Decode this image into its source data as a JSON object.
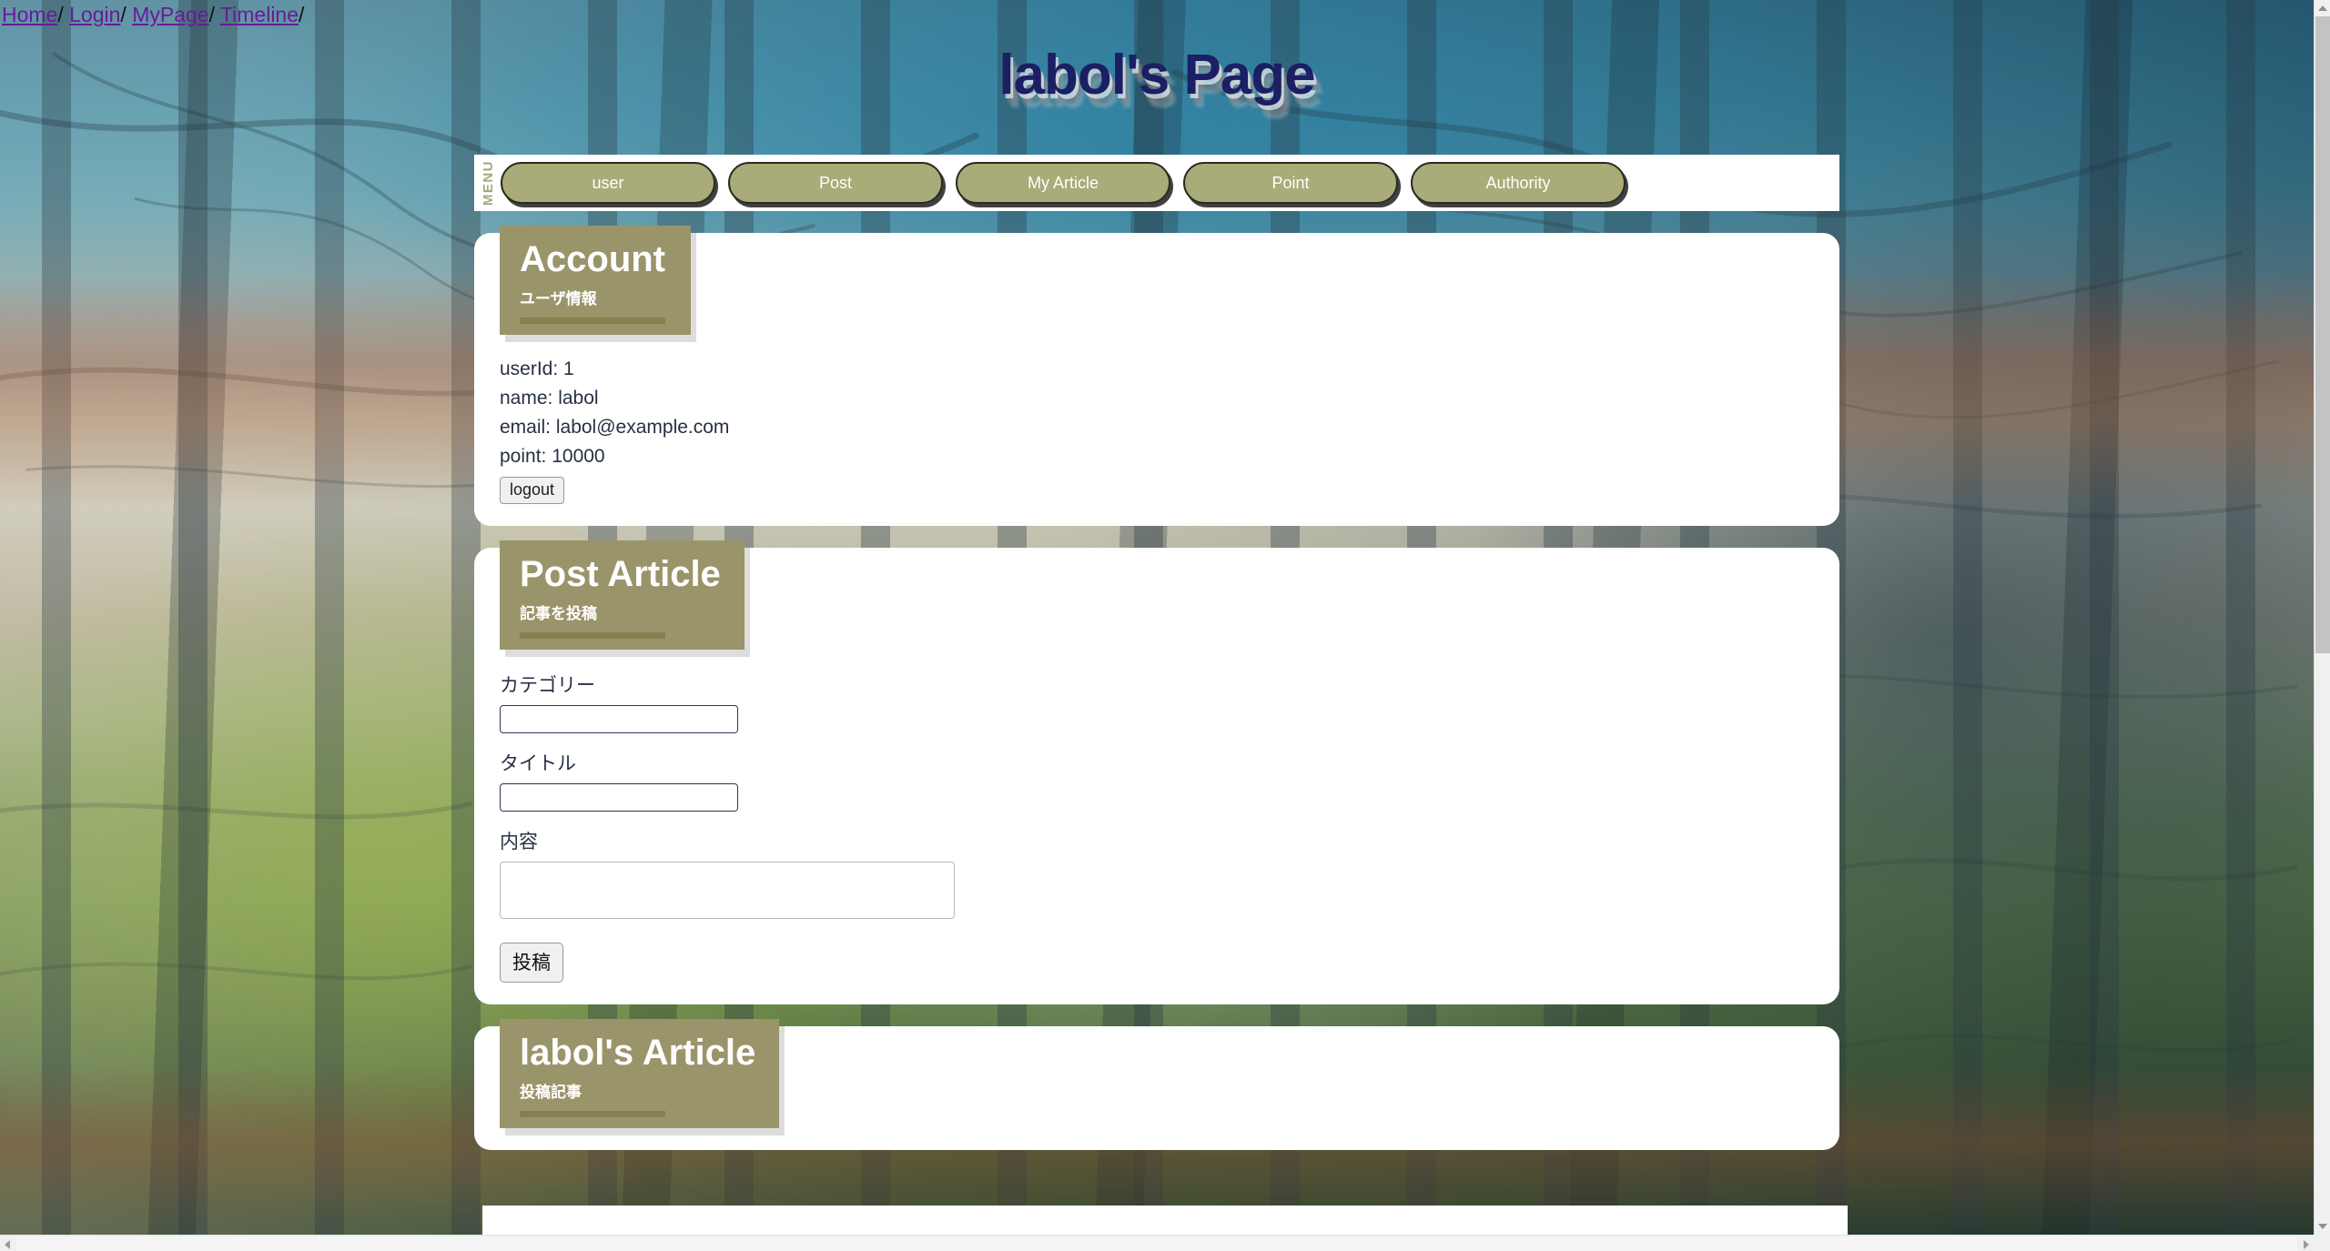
{
  "breadcrumb": {
    "items": [
      {
        "label": "Home",
        "href": "#"
      },
      {
        "label": "Login",
        "href": "#"
      },
      {
        "label": "MyPage",
        "href": "#"
      },
      {
        "label": "Timeline",
        "href": "#"
      }
    ],
    "separator": "/"
  },
  "header": {
    "title": "labol's Page",
    "title_color": "#1c1f63"
  },
  "menu": {
    "label": "MENU",
    "accent_color": "#a9ab78",
    "items": [
      {
        "label": "user"
      },
      {
        "label": "Post"
      },
      {
        "label": "My Article"
      },
      {
        "label": "Point"
      },
      {
        "label": "Authority"
      }
    ]
  },
  "cards": {
    "account": {
      "title": "Account",
      "subtitle": "ユーザ情報",
      "fields": [
        {
          "label": "userId",
          "value": "1",
          "line": "userId: 1"
        },
        {
          "label": "name",
          "value": "labol",
          "line": "name: labol"
        },
        {
          "label": "email",
          "value": "labol@example.com",
          "line": "email: labol@example.com"
        },
        {
          "label": "point",
          "value": "10000",
          "line": "point: 10000"
        }
      ],
      "logout_label": "logout"
    },
    "post_article": {
      "title": "Post Article",
      "subtitle": "記事を投稿",
      "category_label": "カテゴリー",
      "category_value": "",
      "category_placeholder": "",
      "title_label": "タイトル",
      "title_value": "",
      "title_placeholder": "",
      "content_label": "内容",
      "content_value": "",
      "content_placeholder": "",
      "submit_label": "投稿"
    },
    "my_article": {
      "title": "labol's Article",
      "subtitle": "投稿記事"
    }
  },
  "colors": {
    "olive_button": "#a9ab78",
    "olive_header": "#9a946a",
    "olive_rule": "#85804f",
    "link": "#6a1a9a",
    "card_bg": "#ffffff"
  },
  "scrollbars": {
    "vertical_icon_up": "chevron-up-icon",
    "vertical_icon_down": "chevron-down-icon",
    "horizontal_icon_left": "chevron-left-icon",
    "horizontal_icon_right": "chevron-right-icon"
  }
}
